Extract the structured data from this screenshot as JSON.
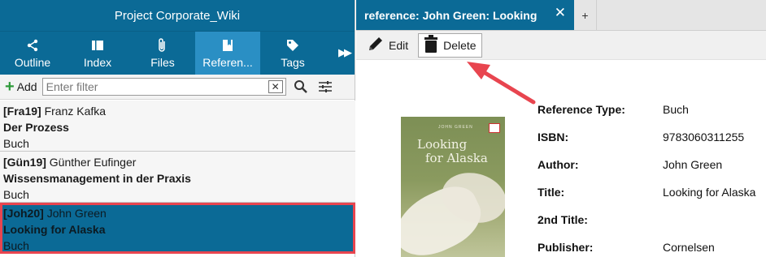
{
  "left_pane": {
    "project_title": "Project Corporate_Wiki",
    "nav": [
      {
        "label": "Outline",
        "icon": "share-icon",
        "active": false
      },
      {
        "label": "Index",
        "icon": "index-icon",
        "active": false
      },
      {
        "label": "Files",
        "icon": "paperclip-icon",
        "active": false
      },
      {
        "label": "Referen...",
        "icon": "bookmark-icon",
        "active": true
      },
      {
        "label": "Tags",
        "icon": "tag-icon",
        "active": false
      }
    ],
    "more_icon": "double-chevron-right-icon",
    "toolbar": {
      "add_label": "Add",
      "filter_placeholder": "Enter filter",
      "clear_icon": "close-icon",
      "search_icon": "search-icon",
      "settings_icon": "sliders-icon"
    },
    "references": [
      {
        "key": "[Fra19]",
        "author": "Franz Kafka",
        "title": "Der Prozess",
        "type": "Buch",
        "selected": false
      },
      {
        "key": "[Gün19]",
        "author": "Günther Eufinger",
        "title": "Wissensmanagement  in der Praxis",
        "type": "Buch",
        "selected": false
      },
      {
        "key": "[Joh20]",
        "author": "John Green",
        "title": "Looking for Alaska",
        "type": "Buch",
        "selected": true
      }
    ]
  },
  "right_pane": {
    "tab_title": "reference: John Green: Looking",
    "tab_add": "+",
    "actions": {
      "edit_label": "Edit",
      "delete_label": "Delete"
    },
    "cover": {
      "title_line1": "Looking",
      "title_line2": "for Alaska",
      "author_text": "JOHN GREEN"
    },
    "details": [
      {
        "label": "Reference Type:",
        "value": "Buch"
      },
      {
        "label": "ISBN:",
        "value": "9783060311255"
      },
      {
        "label": "Author:",
        "value": "John Green"
      },
      {
        "label": "Title:",
        "value": "Looking for Alaska"
      },
      {
        "label": "2nd Title:",
        "value": ""
      },
      {
        "label": "Publisher:",
        "value": "Cornelsen"
      }
    ]
  },
  "colors": {
    "primary": "#0b6a96",
    "active_nav": "#2a8fc4",
    "highlight": "#e8454f",
    "add_green": "#2e9a3a"
  }
}
